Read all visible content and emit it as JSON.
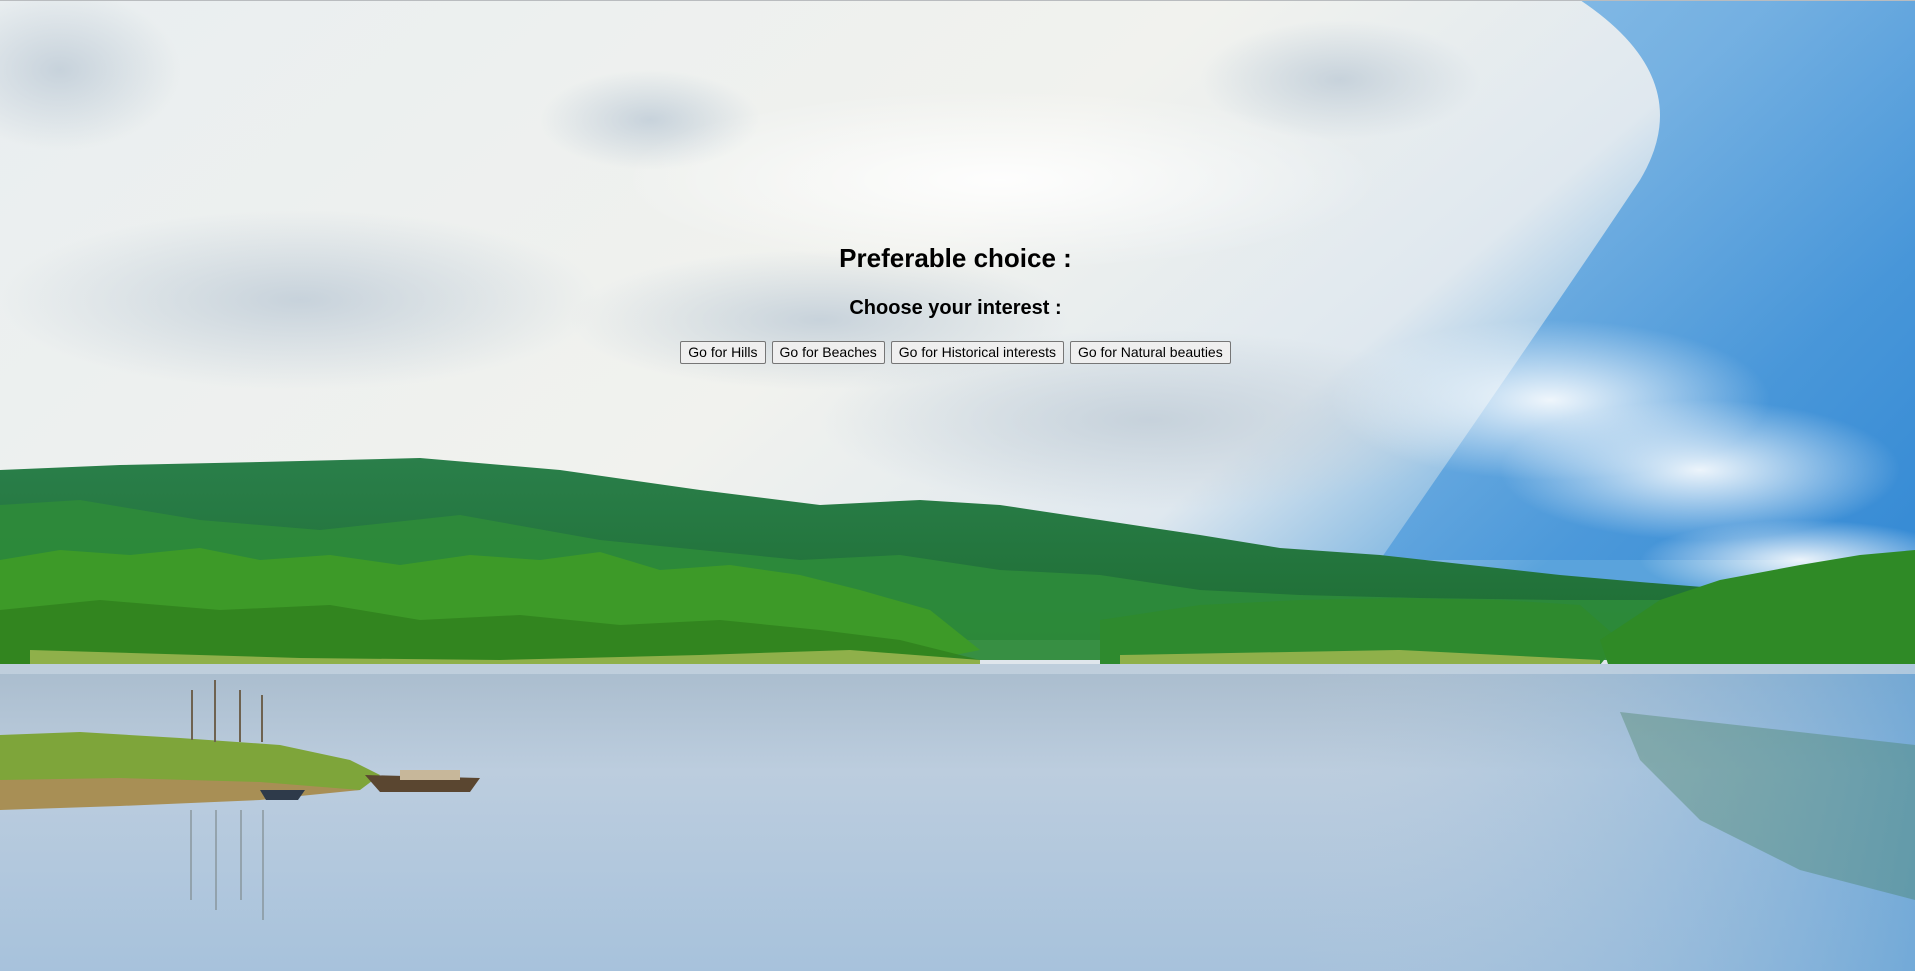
{
  "heading": {
    "title": "Preferable choice :",
    "subtitle": "Choose your interest :"
  },
  "buttons": [
    {
      "label": "Go for Hills"
    },
    {
      "label": "Go for Beaches"
    },
    {
      "label": "Go for Historical interests"
    },
    {
      "label": "Go for Natural beauties"
    }
  ],
  "background": {
    "description_icon": "lake-hills-landscape-image",
    "colors": {
      "sky_light": "#eef0ec",
      "sky_blue": "#3a8fd6",
      "hills_dark": "#1f7a3a",
      "forest_green": "#3e9a2a",
      "water": "#b8cbe0"
    }
  }
}
